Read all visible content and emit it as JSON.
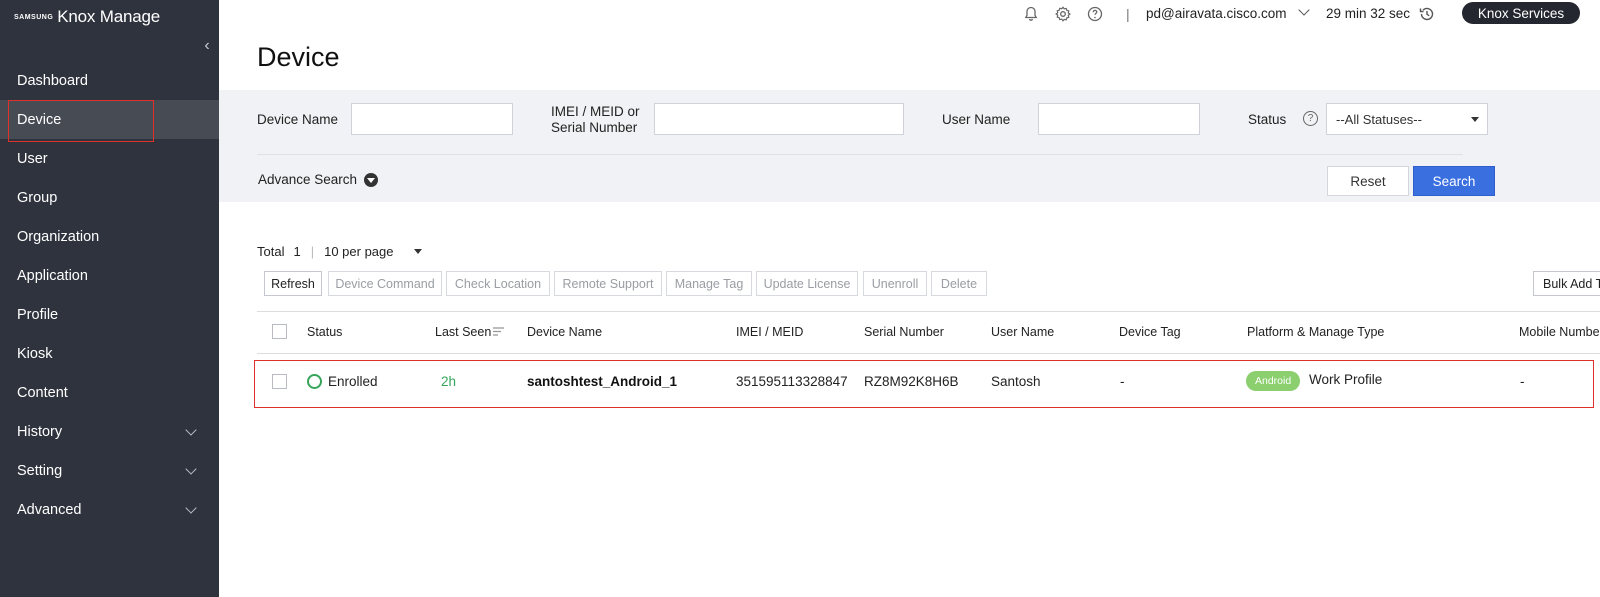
{
  "brand": {
    "samsung": "SAMSUNG",
    "product": "Knox Manage"
  },
  "sidebar": {
    "items": [
      {
        "label": "Dashboard"
      },
      {
        "label": "Device"
      },
      {
        "label": "User"
      },
      {
        "label": "Group"
      },
      {
        "label": "Organization"
      },
      {
        "label": "Application"
      },
      {
        "label": "Profile"
      },
      {
        "label": "Kiosk"
      },
      {
        "label": "Content"
      },
      {
        "label": "History"
      },
      {
        "label": "Setting"
      },
      {
        "label": "Advanced"
      }
    ],
    "active": "Device"
  },
  "topbar": {
    "separator": "|",
    "account_email": "pd@airavata.cisco.com",
    "session_timer": "29 min 32 sec",
    "knox_services_label": "Knox Services"
  },
  "page": {
    "title": "Device"
  },
  "search": {
    "device_name_label": "Device Name",
    "device_name_value": "",
    "imei_label_line1": "IMEI / MEID or",
    "imei_label_line2": "Serial Number",
    "imei_value": "",
    "user_name_label": "User Name",
    "user_name_value": "",
    "status_label": "Status",
    "status_selected": "--All Statuses--",
    "advance_search_label": "Advance Search",
    "reset_label": "Reset",
    "search_label": "Search"
  },
  "results": {
    "total_label": "Total",
    "total_value": "1",
    "separator": "|",
    "per_page": "10 per page"
  },
  "toolbar": {
    "refresh": "Refresh",
    "device_command": "Device Command",
    "check_location": "Check Location",
    "remote_support": "Remote Support",
    "manage_tag": "Manage Tag",
    "update_license": "Update License",
    "unenroll": "Unenroll",
    "delete": "Delete",
    "bulk_add": "Bulk Add T"
  },
  "table": {
    "columns": {
      "status": "Status",
      "last_seen": "Last Seen",
      "device_name": "Device Name",
      "imei": "IMEI / MEID",
      "serial": "Serial Number",
      "user_name": "User Name",
      "device_tag": "Device Tag",
      "platform": "Platform & Manage Type",
      "mobile": "Mobile Numbe"
    },
    "rows": [
      {
        "status": "Enrolled",
        "last_seen": "2h",
        "device_name": "santoshtest_Android_1",
        "imei": "351595113328847",
        "serial": "RZ8M92K8H6B",
        "user_name": "Santosh",
        "device_tag": "-",
        "platform_badge": "Android",
        "manage_type": "Work Profile",
        "mobile": "-"
      }
    ]
  },
  "colors": {
    "sidebar_bg": "#2f333d",
    "accent_blue": "#3a6fe0",
    "status_green": "#36a55a",
    "android_badge": "#8bcf6e",
    "highlight_red": "#e0302a"
  }
}
